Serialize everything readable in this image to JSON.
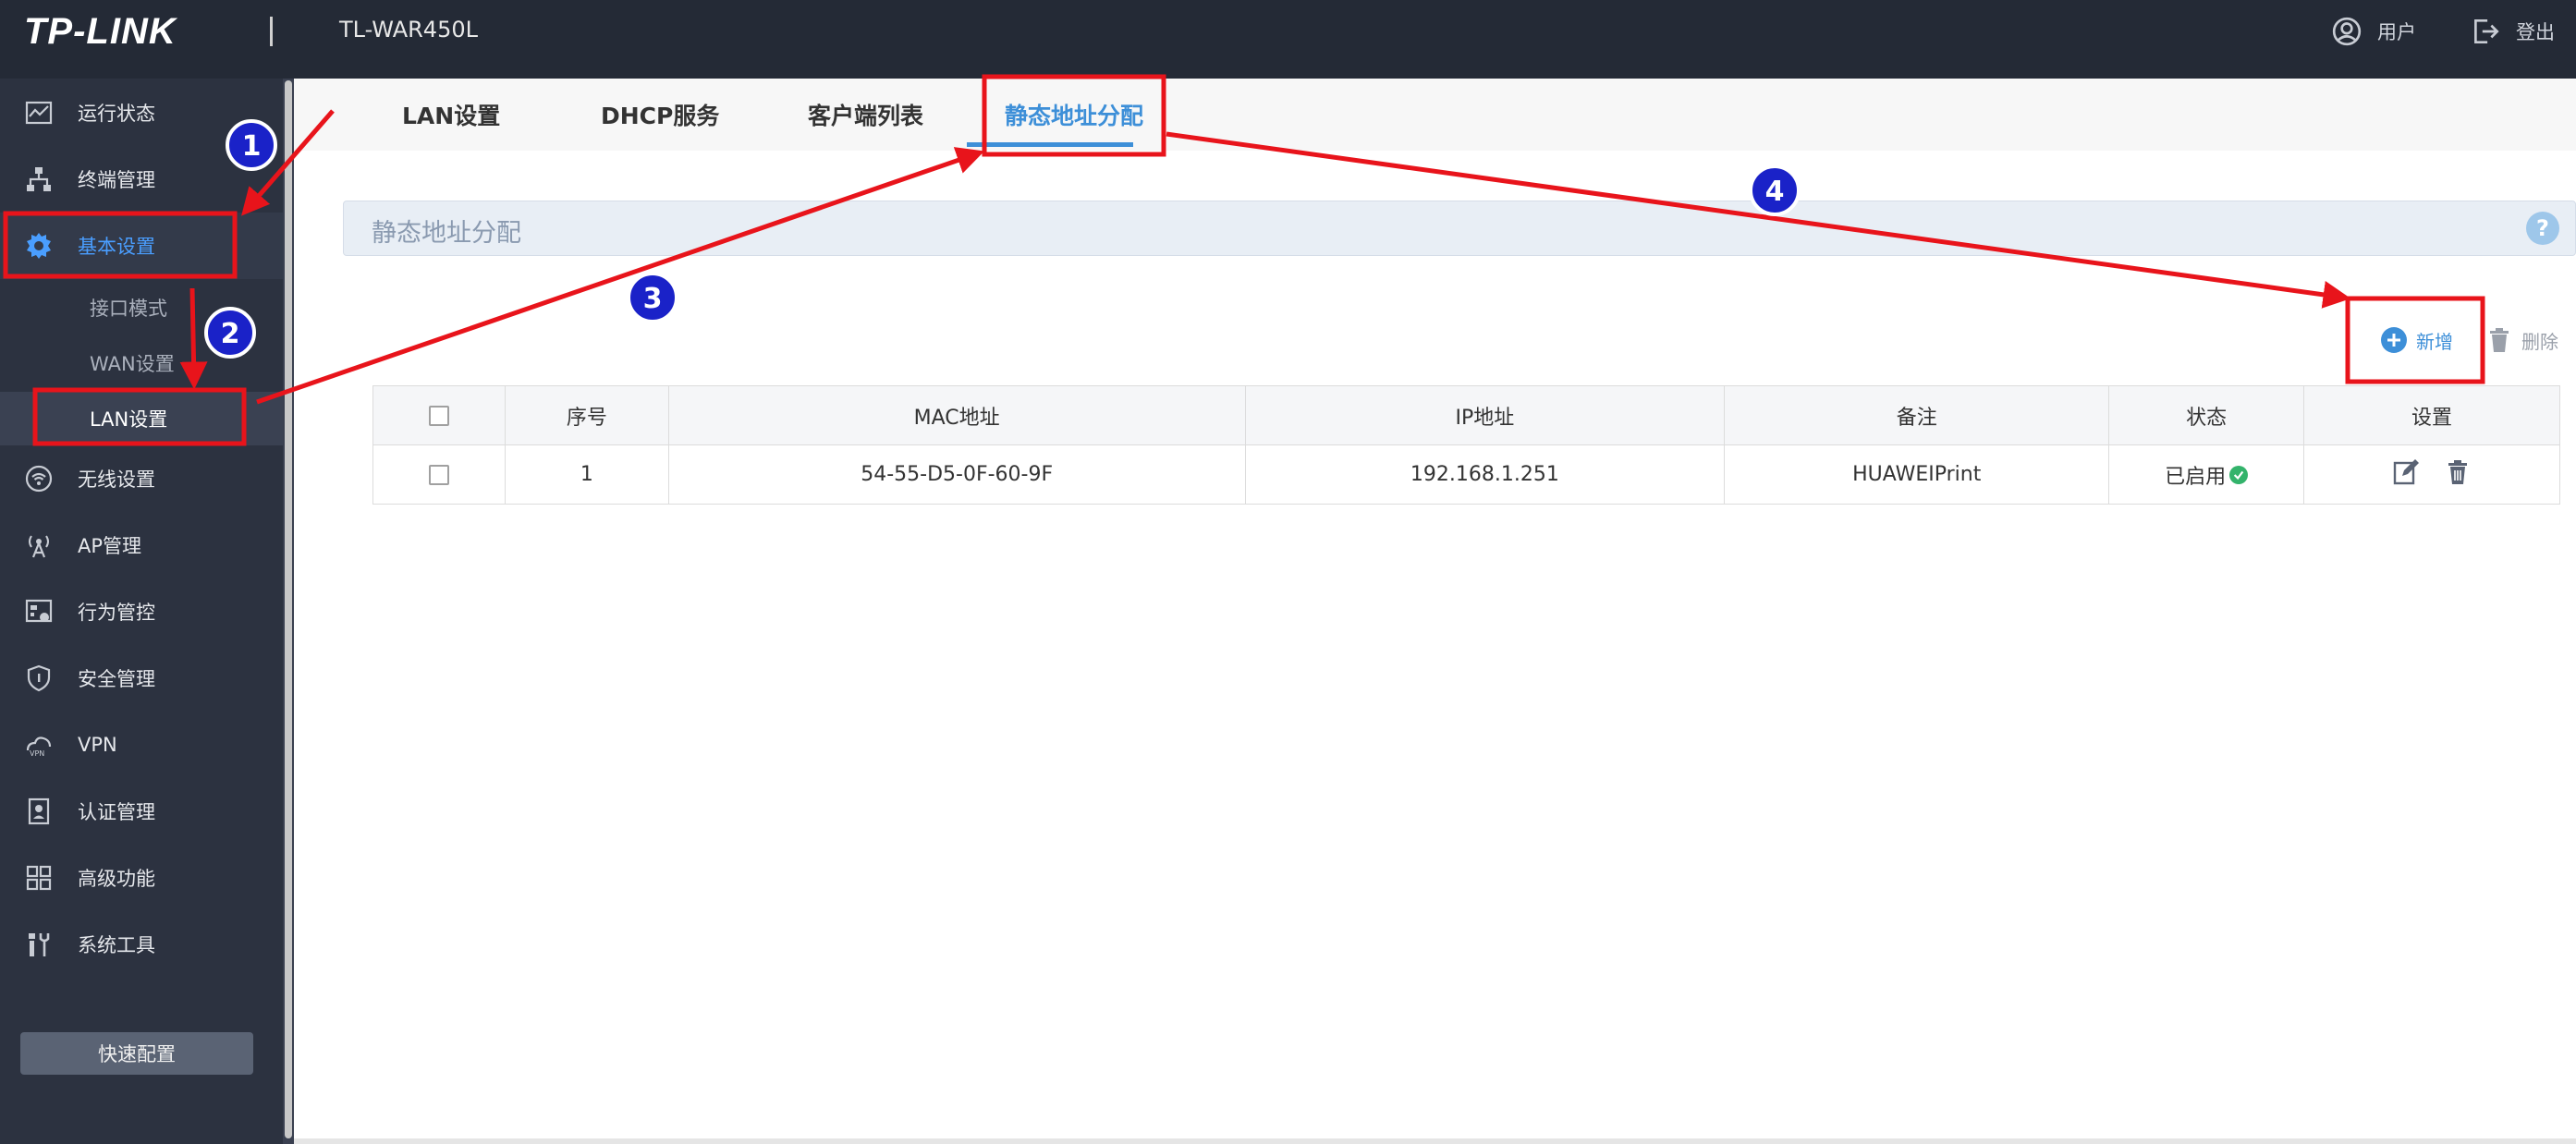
{
  "header": {
    "logo": "TP-LINK",
    "model": "TL-WAR450L",
    "user_label": "用户",
    "logout_label": "登出"
  },
  "sidebar": {
    "items": [
      {
        "label": "运行状态",
        "icon": "chart-line-icon"
      },
      {
        "label": "终端管理",
        "icon": "network-tree-icon"
      },
      {
        "label": "基本设置",
        "icon": "gear-icon"
      },
      {
        "label": "无线设置",
        "icon": "wifi-icon"
      },
      {
        "label": "AP管理",
        "icon": "antenna-icon"
      },
      {
        "label": "行为管控",
        "icon": "control-panel-icon"
      },
      {
        "label": "安全管理",
        "icon": "shield-icon"
      },
      {
        "label": "VPN",
        "icon": "vpn-cloud-icon"
      },
      {
        "label": "认证管理",
        "icon": "badge-user-icon"
      },
      {
        "label": "高级功能",
        "icon": "grid-apps-icon"
      },
      {
        "label": "系统工具",
        "icon": "tools-icon"
      }
    ],
    "sub_items": [
      {
        "label": "接口模式"
      },
      {
        "label": "WAN设置"
      },
      {
        "label": "LAN设置"
      }
    ],
    "quick_config_label": "快速配置"
  },
  "tabs": [
    {
      "label": "LAN设置"
    },
    {
      "label": "DHCP服务"
    },
    {
      "label": "客户端列表"
    },
    {
      "label": "静态地址分配"
    }
  ],
  "section": {
    "title": "静态地址分配",
    "help": "?"
  },
  "toolbar": {
    "add_label": "新增",
    "delete_label": "删除"
  },
  "table": {
    "columns": [
      "序号",
      "MAC地址",
      "IP地址",
      "备注",
      "状态",
      "设置"
    ],
    "rows": [
      {
        "index": "1",
        "mac": "54-55-D5-0F-60-9F",
        "ip": "192.168.1.251",
        "note": "HUAWEIPrint",
        "status": "已启用"
      }
    ]
  },
  "annotations": {
    "badges": [
      "1",
      "2",
      "3",
      "4"
    ],
    "color": "#e8141b",
    "badge_color": "#1a22c8"
  }
}
